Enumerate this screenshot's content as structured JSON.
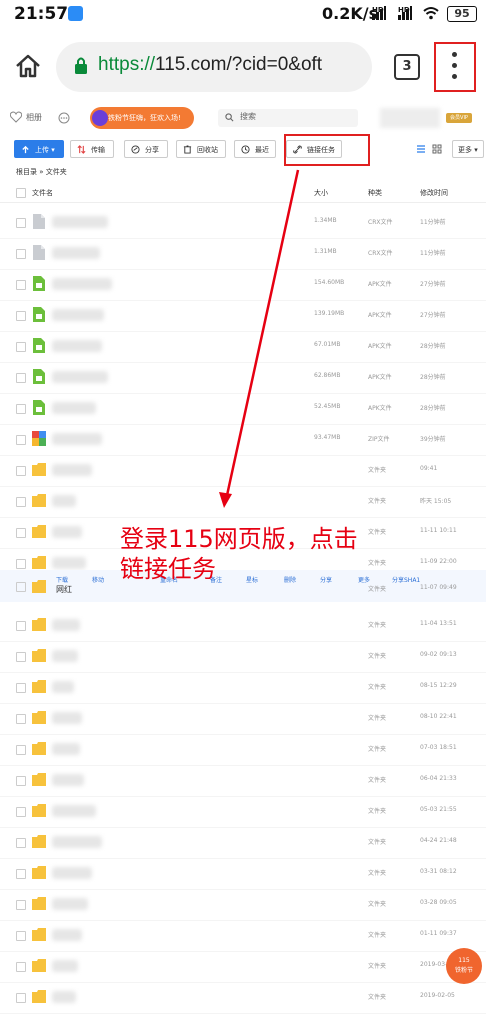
{
  "status_bar": {
    "time": "21:57",
    "speed": "0.2K/s",
    "hd1": "HD",
    "hd2": "HD",
    "battery": "95"
  },
  "browser": {
    "url_scheme": "https://",
    "url_rest": "115.com/?cid=0&oft",
    "tab_count": "3"
  },
  "topbar": {
    "album": "相册",
    "ad_text": "铁粉节狂嗨，狂欢入场!",
    "search_placeholder": "搜索",
    "vip": "会员VIP"
  },
  "toolbar": {
    "upload": "上传",
    "transfer": "传输",
    "share": "分享",
    "recycle": "回收站",
    "recent": "最近",
    "link_task": "链接任务",
    "more": "更多"
  },
  "breadcrumb": {
    "root": "根目录",
    "sep": "»",
    "current": "文件夹"
  },
  "table_header": {
    "name": "文件名",
    "size": "大小",
    "type": "种类",
    "modified": "修改时间"
  },
  "rows": [
    {
      "icon": "crx",
      "size": "1.34MB",
      "type": "CRX文件",
      "time": "11分钟前"
    },
    {
      "icon": "crx",
      "size": "1.31MB",
      "type": "CRX文件",
      "time": "11分钟前"
    },
    {
      "icon": "apk",
      "size": "154.60MB",
      "type": "APK文件",
      "time": "27分钟前"
    },
    {
      "icon": "apk",
      "size": "139.19MB",
      "type": "APK文件",
      "time": "27分钟前"
    },
    {
      "icon": "apk",
      "size": "67.01MB",
      "type": "APK文件",
      "time": "28分钟前"
    },
    {
      "icon": "apk",
      "size": "62.86MB",
      "type": "APK文件",
      "time": "28分钟前"
    },
    {
      "icon": "apk",
      "size": "52.45MB",
      "type": "APK文件",
      "time": "28分钟前"
    },
    {
      "icon": "zip",
      "size": "93.47MB",
      "type": "ZIP文件",
      "time": "39分钟前"
    },
    {
      "icon": "folder",
      "size": "",
      "type": "文件夹",
      "time": "09:41"
    },
    {
      "icon": "folder",
      "size": "",
      "type": "文件夹",
      "time": "昨天 15:05"
    },
    {
      "icon": "folder",
      "size": "",
      "type": "文件夹",
      "time": "11-11 10:11"
    },
    {
      "icon": "folder",
      "size": "",
      "type": "文件夹",
      "time": "11-09 22:00"
    },
    {
      "icon": "folder",
      "size": "",
      "type": "文件夹",
      "time": "11-07 09:49"
    },
    {
      "icon": "folder",
      "size": "",
      "type": "文件夹",
      "time": "11-04 13:51"
    },
    {
      "icon": "folder",
      "size": "",
      "type": "文件夹",
      "time": "09-02 09:13"
    },
    {
      "icon": "folder",
      "size": "",
      "type": "文件夹",
      "time": "08-15 12:29"
    },
    {
      "icon": "folder",
      "size": "",
      "type": "文件夹",
      "time": "08-10 22:41"
    },
    {
      "icon": "folder",
      "size": "",
      "type": "文件夹",
      "time": "07-03 18:51"
    },
    {
      "icon": "folder",
      "size": "",
      "type": "文件夹",
      "time": "06-04 21:33"
    },
    {
      "icon": "folder",
      "size": "",
      "type": "文件夹",
      "time": "05-03 21:55"
    },
    {
      "icon": "folder",
      "size": "",
      "type": "文件夹",
      "time": "04-24 21:48"
    },
    {
      "icon": "folder",
      "size": "",
      "type": "文件夹",
      "time": "03-31 08:12"
    },
    {
      "icon": "folder",
      "size": "",
      "type": "文件夹",
      "time": "03-28 09:05"
    },
    {
      "icon": "folder",
      "size": "",
      "type": "文件夹",
      "time": "01-11 09:37"
    },
    {
      "icon": "folder",
      "size": "",
      "type": "文件夹",
      "time": "2019-03-05"
    },
    {
      "icon": "folder",
      "size": "",
      "type": "文件夹",
      "time": "2019-02-05"
    }
  ],
  "hover_row": {
    "name": "网红",
    "actions": [
      "下载",
      "移动",
      "重命名",
      "备注",
      "星标",
      "删除",
      "分享",
      "更多",
      "分享SHA1"
    ]
  },
  "annotation": {
    "line1": "登录115网页版，点击",
    "line2": "链接任务"
  },
  "float_badge": {
    "line1": "115",
    "line2": "铁粉节"
  },
  "colors": {
    "accent": "#2b7de9",
    "annotation": "#e60012",
    "https": "#0a8a3a"
  }
}
